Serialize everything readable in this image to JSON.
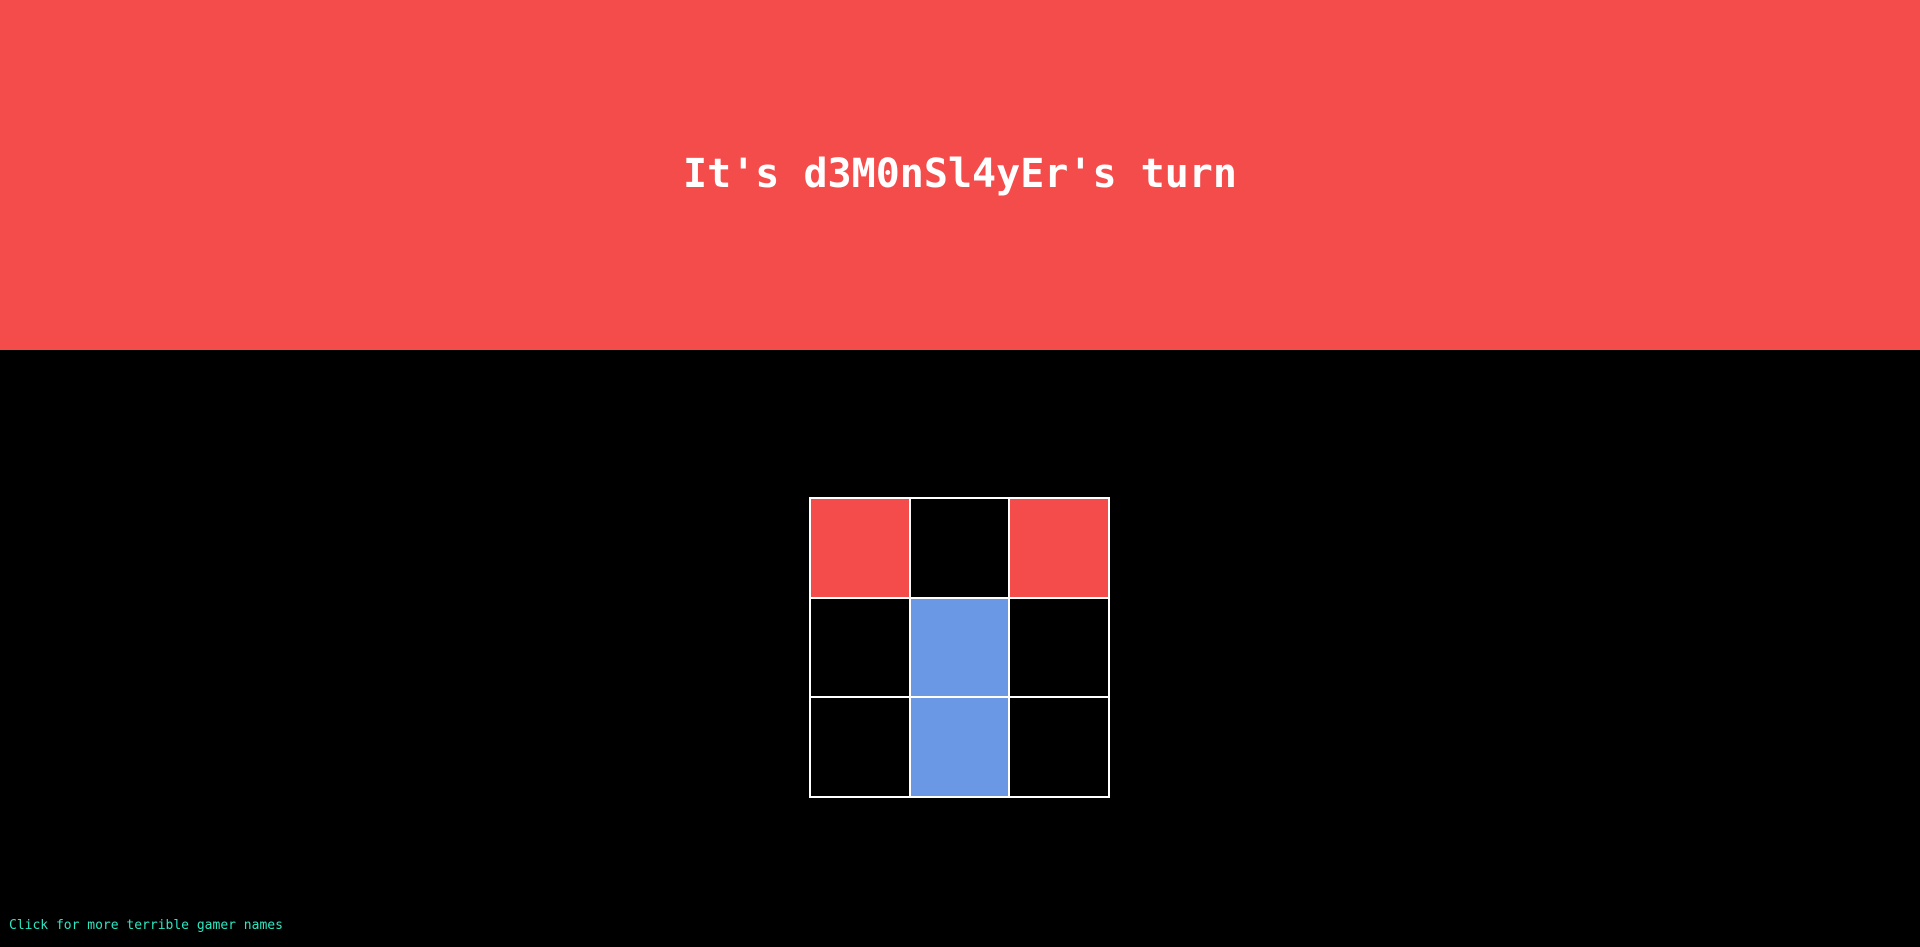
{
  "banner": {
    "turn_text": "It's d3M0nSl4yEr's turn",
    "color": "#f44b4b"
  },
  "board": {
    "cells": [
      {
        "owner": "red"
      },
      {
        "owner": "empty"
      },
      {
        "owner": "red"
      },
      {
        "owner": "empty"
      },
      {
        "owner": "blue"
      },
      {
        "owner": "empty"
      },
      {
        "owner": "empty"
      },
      {
        "owner": "blue"
      },
      {
        "owner": "empty"
      }
    ],
    "colors": {
      "red": "#f44b4b",
      "blue": "#6a98e4",
      "empty": "#000000",
      "grid": "#ffffff"
    }
  },
  "footer": {
    "link_text": "Click for more terrible gamer names",
    "color": "#2ee6c2"
  }
}
